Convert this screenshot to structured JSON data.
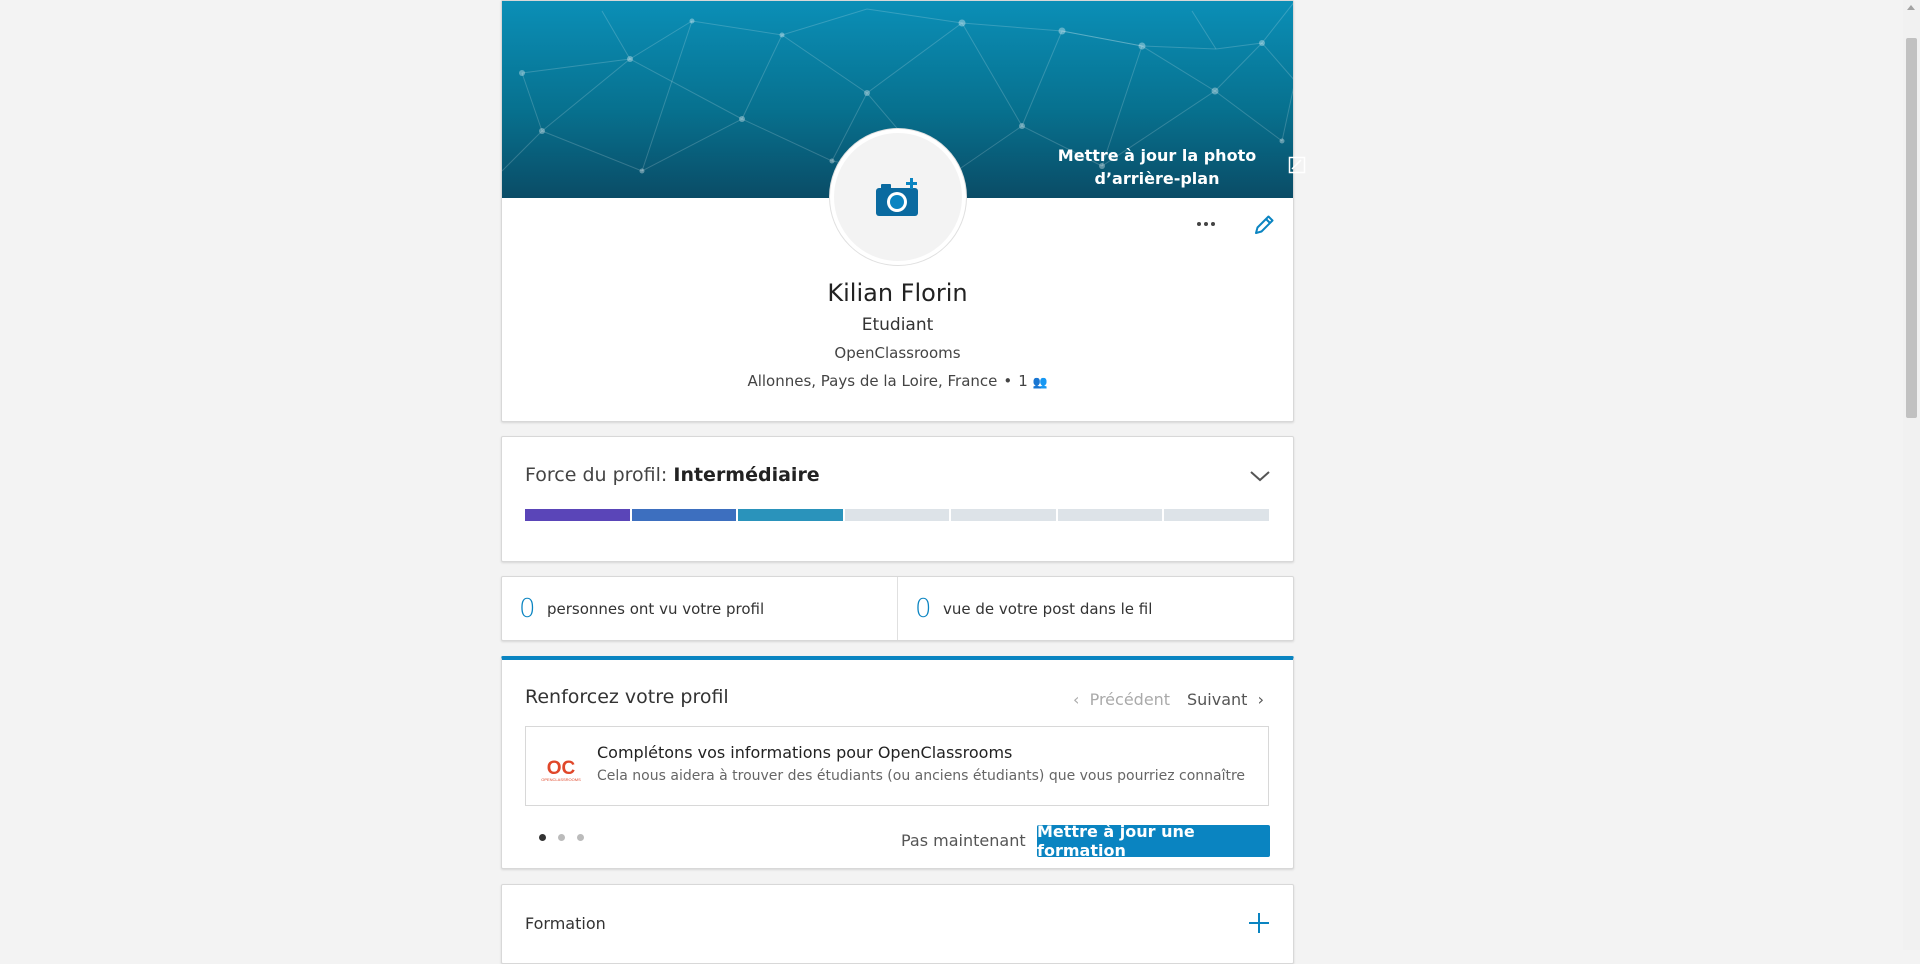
{
  "profile": {
    "banner_update_label": "Mettre à jour la photo d’arrière-plan",
    "name": "Kilian Florin",
    "headline": "Etudiant",
    "company": "OpenClassrooms",
    "location": "Allonnes, Pays de la Loire, France",
    "connections": "1"
  },
  "strength": {
    "label": "Force du profil:",
    "level": "Intermédiaire",
    "segments_total": 7,
    "segments_filled": 3,
    "segment_colors": [
      "#5a45b8",
      "#3d6fbf",
      "#2a93bb"
    ]
  },
  "stats": [
    {
      "value": "0",
      "label": "personnes ont vu votre profil"
    },
    {
      "value": "0",
      "label": "vue de votre post dans le fil"
    }
  ],
  "boost": {
    "title": "Renforcez votre profil",
    "prev_label": "Précédent",
    "next_label": "Suivant",
    "card_title": "Complétons vos informations pour OpenClassrooms",
    "card_subtitle": "Cela nous aidera à trouver des étudiants (ou anciens étudiants) que vous pourriez connaître",
    "logo_text": "OC",
    "logo_subtext": "OPENCLASSROOMS",
    "not_now_label": "Pas maintenant",
    "cta_label": "Mettre à jour une formation",
    "page_count": 3,
    "active_page": 1
  },
  "formation": {
    "title": "Formation"
  },
  "colors": {
    "accent": "#0a84c1",
    "background": "#f3f3f3"
  },
  "icons": {
    "camera": "camera-add-icon",
    "more": "more-icon",
    "edit": "pencil-icon",
    "chevron": "chevron-down-icon",
    "add": "plus-icon"
  }
}
